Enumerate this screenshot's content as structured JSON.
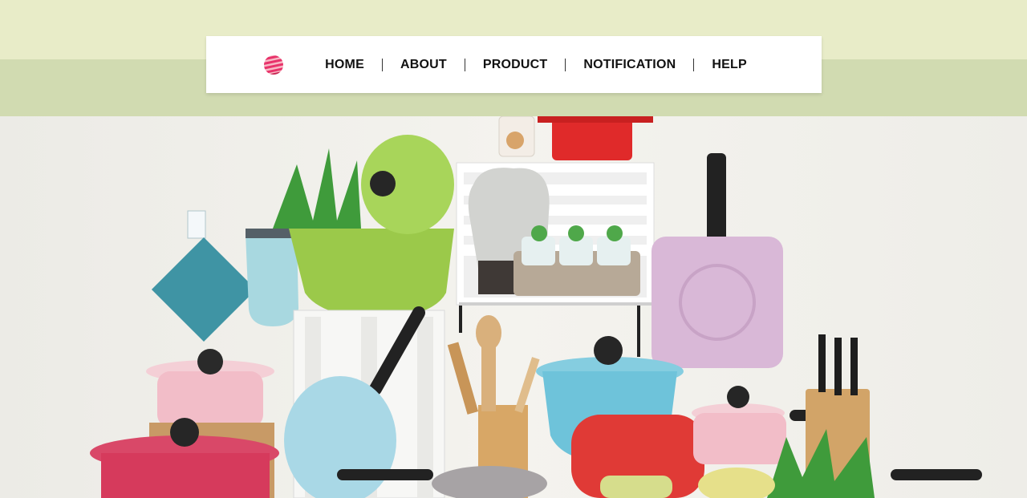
{
  "nav": {
    "items": [
      {
        "label": "HOME"
      },
      {
        "label": "ABOUT"
      },
      {
        "label": "PRODUCT"
      },
      {
        "label": "NOTIFICATION"
      },
      {
        "label": "HELP"
      }
    ]
  },
  "colors": {
    "band_top": "#e8ecc8",
    "band_bottom": "#d1dbb1",
    "navbar_bg": "#ffffff",
    "logo_accent": "#e8336b"
  },
  "icons": {
    "logo": "striped-globe-logo-icon"
  }
}
